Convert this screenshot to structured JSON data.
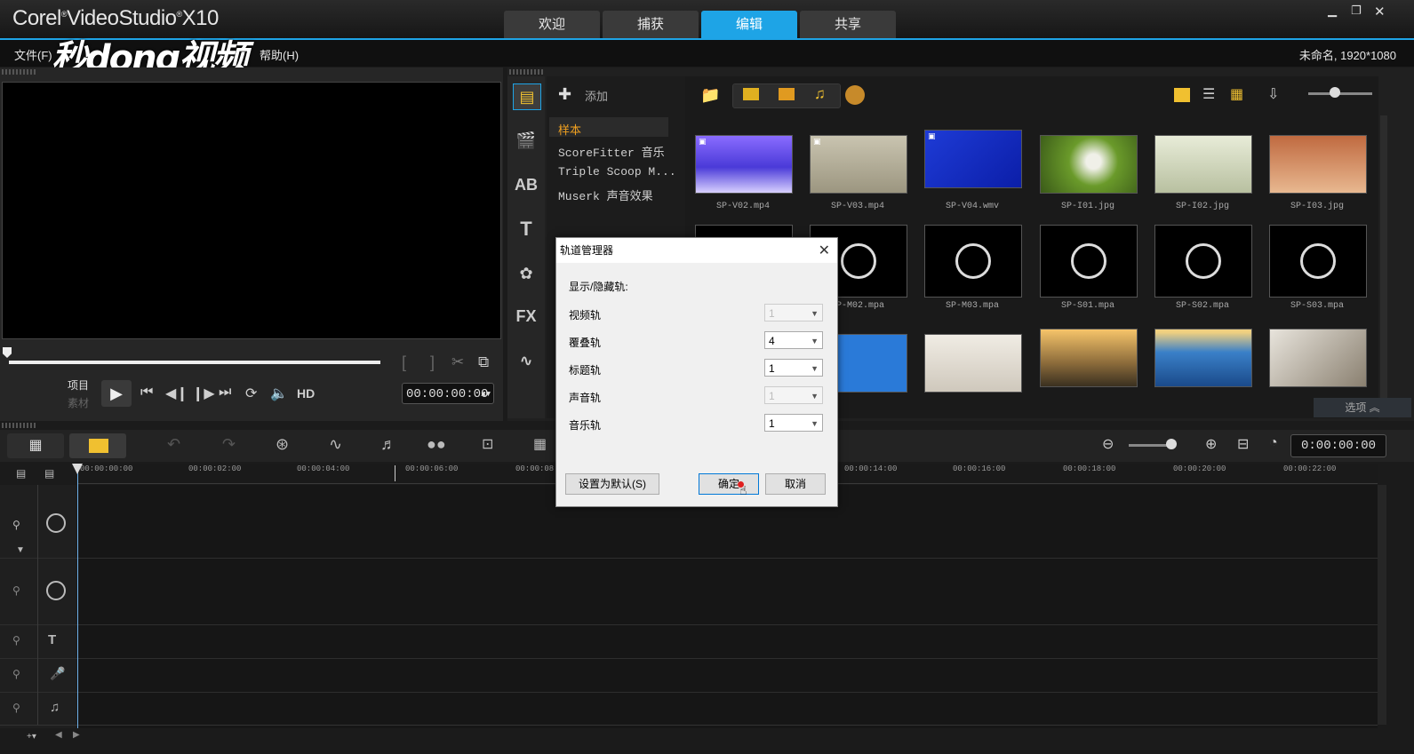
{
  "app": {
    "title": "Corel VideoStudio X10",
    "brand": "Corel",
    "product": "VideoStudio",
    "version": "X10"
  },
  "main_tabs": [
    {
      "label": "欢迎",
      "active": false
    },
    {
      "label": "捕获",
      "active": false
    },
    {
      "label": "编辑",
      "active": true
    },
    {
      "label": "共享",
      "active": false
    }
  ],
  "menus": {
    "file": "文件(F)",
    "help": "帮助(H)"
  },
  "watermark": "秒dong视频",
  "project_info": "未命名, 1920*1080",
  "preview": {
    "mode_project": "项目",
    "mode_clip": "素材",
    "hd": "HD",
    "timecode": "00:00:00:00"
  },
  "library": {
    "add_label": "添加",
    "icon_fx": "FX",
    "categories": [
      "样本",
      "ScoreFitter 音乐",
      "Triple Scoop M...",
      "Muserk 声音效果"
    ],
    "rows": [
      [
        {
          "name": "SP-V02.mp4"
        },
        {
          "name": "SP-V03.mp4"
        },
        {
          "name": "SP-V04.wmv"
        },
        {
          "name": "SP-I01.jpg"
        },
        {
          "name": "SP-I02.jpg"
        },
        {
          "name": "SP-I03.jpg"
        }
      ],
      [
        {
          "name": "SP-M02.mpa"
        },
        {
          "name": "SP-M03.mpa"
        },
        {
          "name": "SP-S01.mpa"
        },
        {
          "name": "SP-S02.mpa"
        },
        {
          "name": "SP-S03.mpa"
        }
      ]
    ],
    "options_label": "选项"
  },
  "timeline": {
    "timecode": "0:00:00:00",
    "ticks": [
      "00:00:00:00",
      "00:00:02:00",
      "00:00:04:00",
      "00:00:06:00",
      "00:00:08",
      "00:00:14:00",
      "00:00:16:00",
      "00:00:18:00",
      "00:00:20:00",
      "00:00:22:00"
    ]
  },
  "dialog": {
    "title": "轨道管理器",
    "section": "显示/隐藏轨:",
    "tracks": [
      {
        "label": "视频轨",
        "value": "1",
        "enabled": false
      },
      {
        "label": "覆叠轨",
        "value": "4",
        "enabled": true
      },
      {
        "label": "标题轨",
        "value": "1",
        "enabled": true
      },
      {
        "label": "声音轨",
        "value": "1",
        "enabled": false
      },
      {
        "label": "音乐轨",
        "value": "1",
        "enabled": true
      }
    ],
    "default_button": "设置为默认(S)",
    "ok_button": "确定",
    "cancel_button": "取消"
  },
  "colors": {
    "accent": "#1ea4e6",
    "background": "#1b1b1b"
  }
}
